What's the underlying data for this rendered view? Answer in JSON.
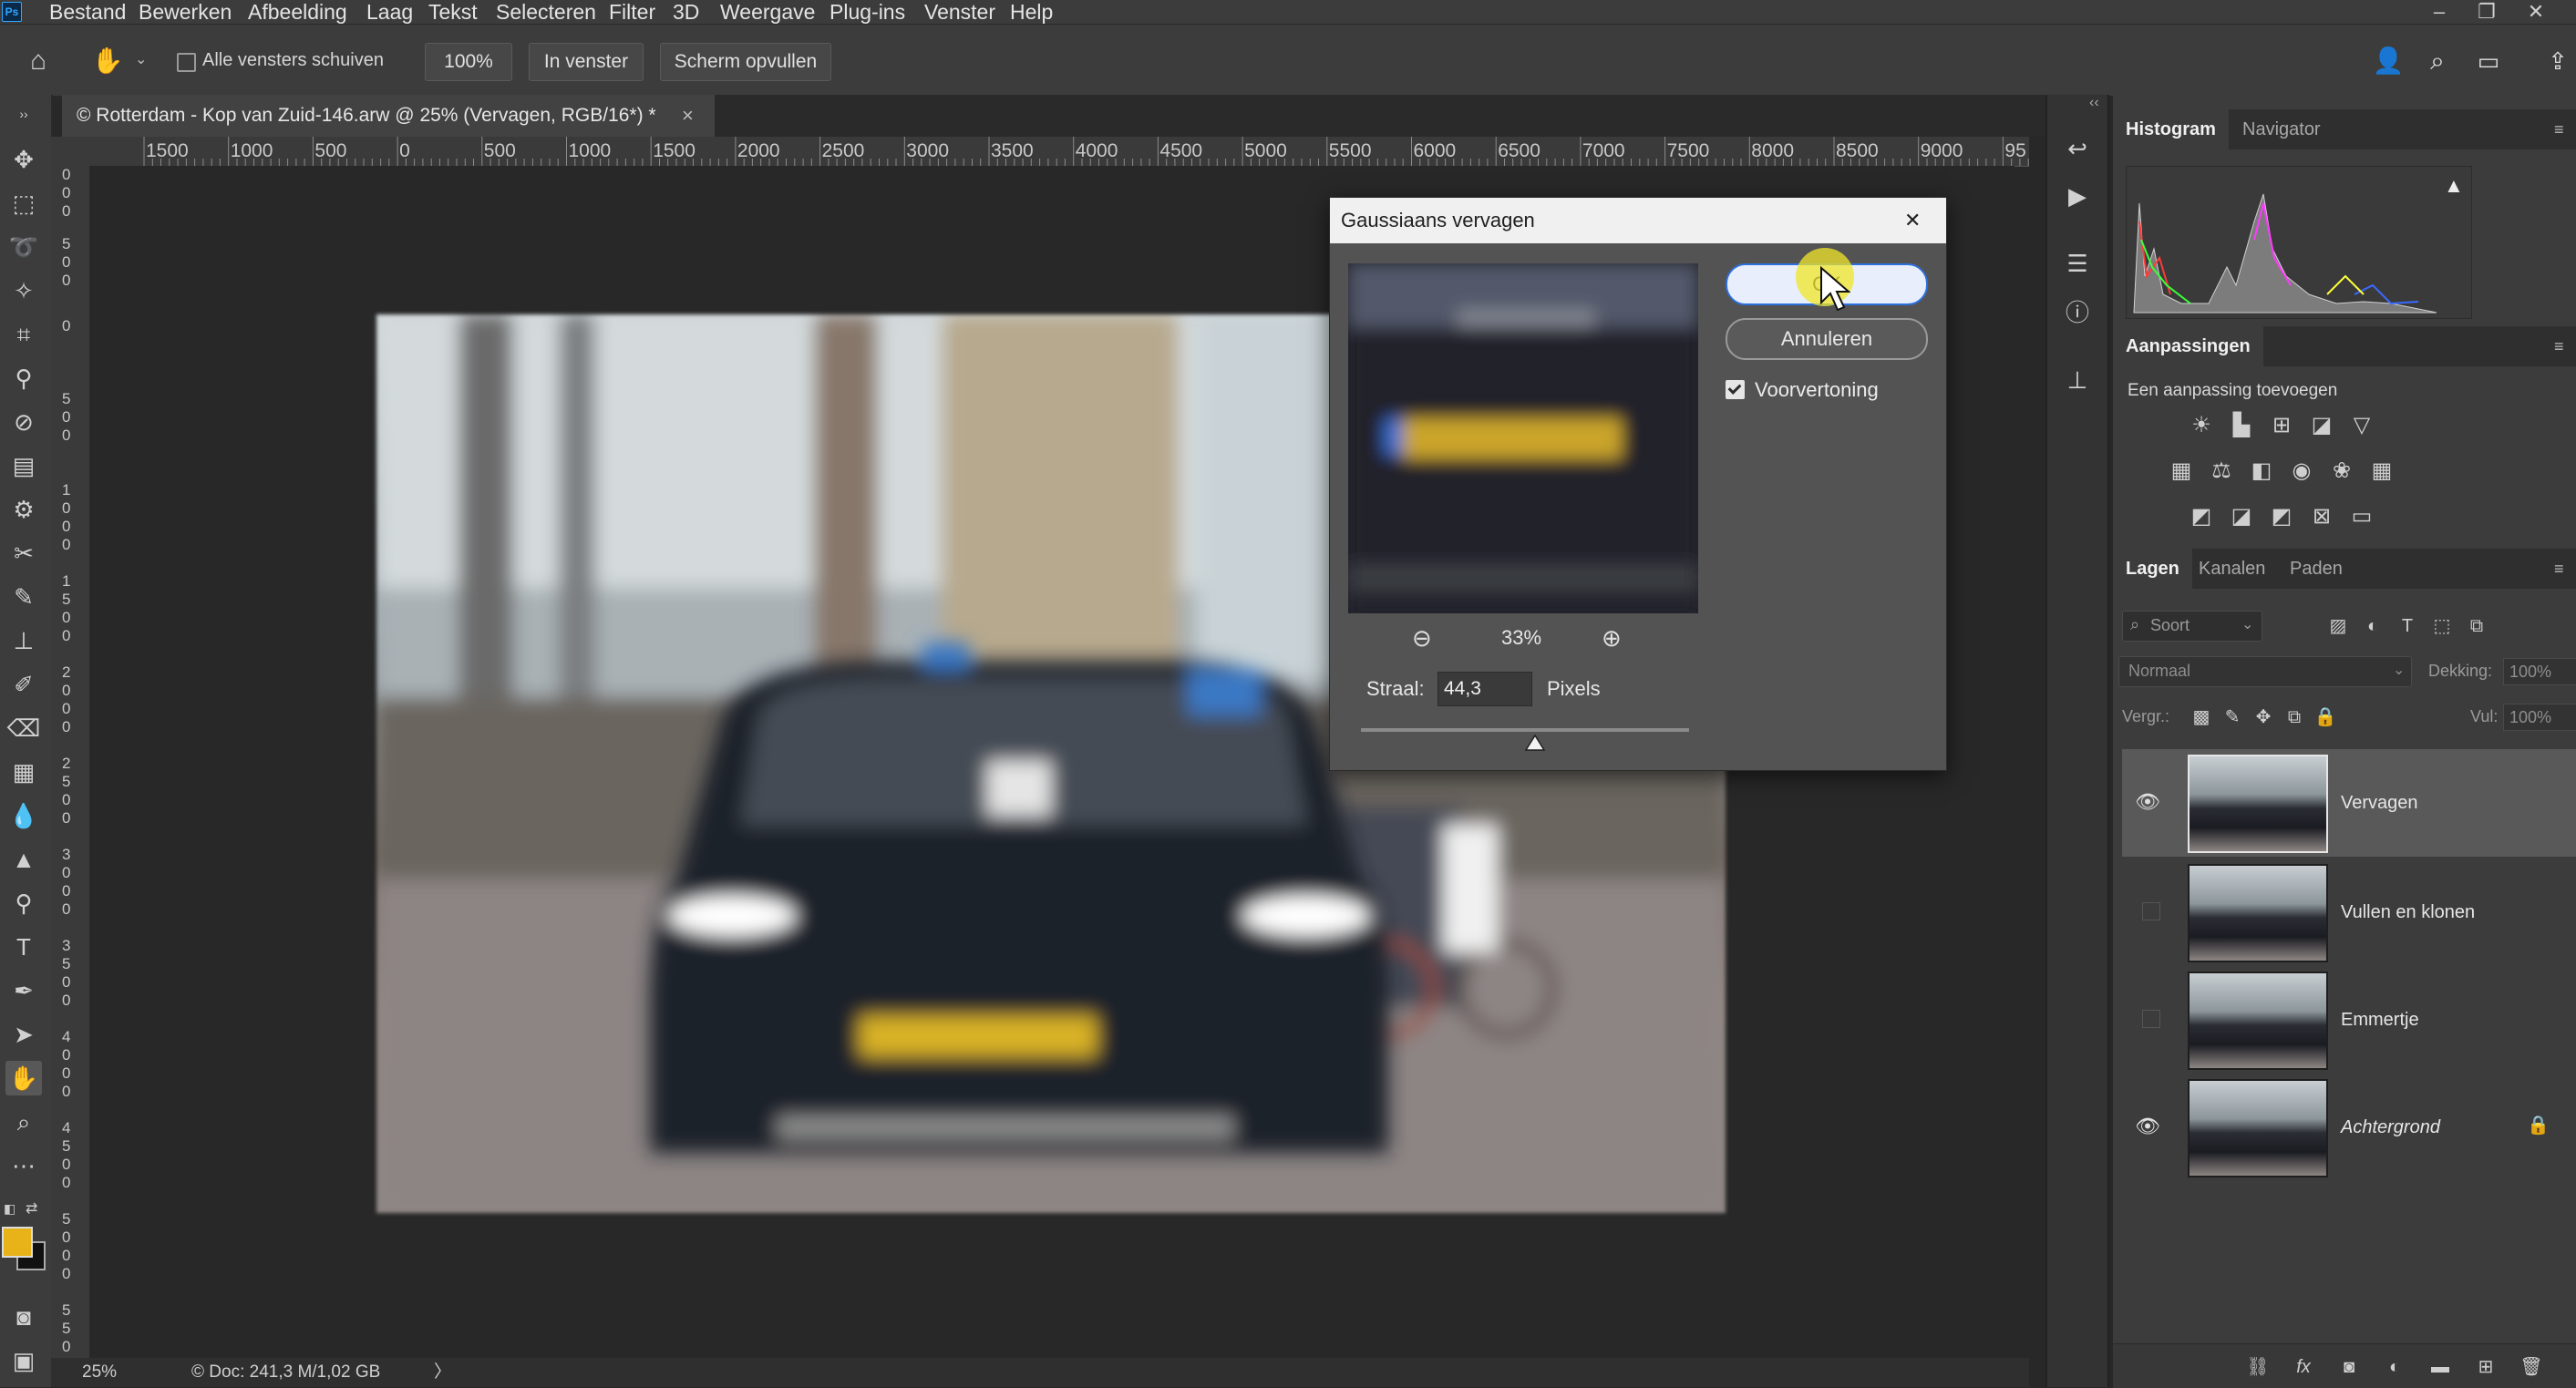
{
  "menubar": {
    "app_logo": "Ps",
    "items": [
      "Bestand",
      "Bewerken",
      "Afbeelding",
      "Laag",
      "Tekst",
      "Selecteren",
      "Filter",
      "3D",
      "Weergave",
      "Plug-ins",
      "Venster",
      "Help"
    ]
  },
  "optionsbar": {
    "scroll_all_label": "Alle vensters schuiven",
    "zoom_value": "100%",
    "fit_window_label": "In venster",
    "fill_screen_label": "Scherm opvullen"
  },
  "document": {
    "tab_title": "© Rotterdam - Kop van Zuid-146.arw @ 25% (Vervagen, RGB/16*) *",
    "close_glyph": "×"
  },
  "ruler": {
    "h_labels": [
      "1500",
      "1000",
      "500",
      "0",
      "500",
      "1000",
      "1500",
      "2000",
      "2500",
      "3000",
      "3500",
      "4000",
      "4500",
      "5000",
      "5500",
      "6000",
      "6500",
      "7000",
      "7500",
      "8000",
      "8500",
      "9000",
      "95"
    ]
  },
  "statusbar": {
    "zoom": "25%",
    "doc_info": "© Doc: 241,3 M/1,02 GB",
    "arrow": "〉"
  },
  "panels": {
    "top_tabs": [
      "Histogram",
      "Navigator"
    ],
    "adjustments_title": "Aanpassingen",
    "adjustments_hint": "Een aanpassing toevoegen",
    "layer_tabs": [
      "Lagen",
      "Kanalen",
      "Paden"
    ],
    "kind_placeholder": "Soort",
    "blend_mode": "Normaal",
    "opacity_label": "Dekking:",
    "opacity_value": "100%",
    "lock_label": "Vergr.:",
    "fill_label": "Vul:",
    "fill_value": "100%"
  },
  "layers": [
    {
      "name": "Vervagen",
      "visible": true,
      "selected": true
    },
    {
      "name": "Vullen en klonen",
      "visible": false,
      "selected": false
    },
    {
      "name": "Emmertje",
      "visible": false,
      "selected": false
    },
    {
      "name": "Achtergrond",
      "visible": true,
      "selected": false,
      "locked": true
    }
  ],
  "dialog": {
    "title": "Gaussiaans vervagen",
    "close_glyph": "✕",
    "ok_label": "OK",
    "cancel_label": "Annuleren",
    "preview_label": "Voorvertoning",
    "preview_checked": true,
    "zoom_percent": "33%",
    "radius_label": "Straal:",
    "radius_value": "44,3",
    "radius_unit": "Pixels",
    "radius_slider_fraction": 0.53
  },
  "colors": {
    "foreground": "#e8b318",
    "background": "#111111",
    "accent": "#2d6fdc"
  }
}
